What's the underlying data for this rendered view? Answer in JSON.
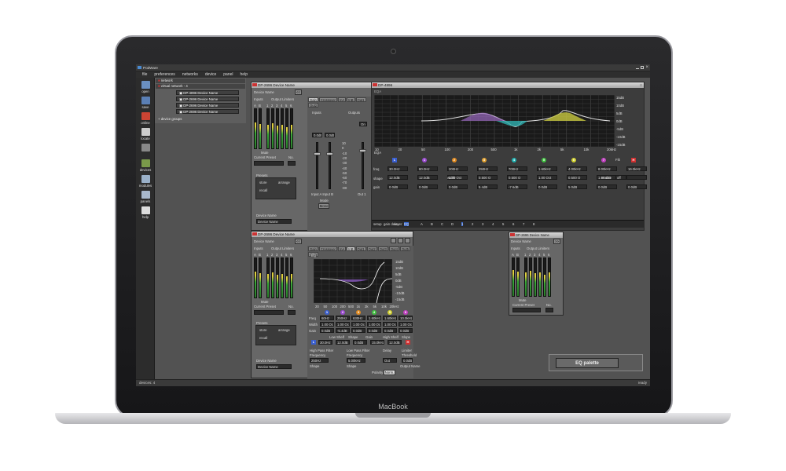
{
  "app": {
    "title": "PodWare",
    "status_devices": "devices: 4",
    "status_ready": "ready",
    "laptop_brand": "MacBook"
  },
  "menu": [
    "file",
    "preferences",
    "networks",
    "device",
    "panel",
    "help"
  ],
  "sidebar": [
    {
      "label": "open",
      "icon": "folder-icon",
      "color": "#6a8fc0"
    },
    {
      "label": "save",
      "icon": "save-icon",
      "color": "#5a7fb5"
    },
    {
      "label": "online",
      "icon": "play-icon",
      "color": "#c43"
    },
    {
      "label": "locate",
      "icon": "locate-icon",
      "color": "#ccc"
    },
    {
      "label": "",
      "icon": "gear-icon",
      "color": "#888"
    },
    {
      "label": "devices",
      "icon": "devices-icon",
      "color": "#7a9a4a"
    },
    {
      "label": "modules",
      "icon": "modules-icon",
      "color": "#9ab0c8"
    },
    {
      "label": "panels",
      "icon": "panels-icon",
      "color": "#a8b8cc"
    },
    {
      "label": "help",
      "icon": "help-icon",
      "color": "#ddd"
    }
  ],
  "tree": {
    "network": "network",
    "virtual_network": "virtual network - 4",
    "devices": [
      "DP-4896 Device Name",
      "DP-2696 Device Name",
      "DP-2696 Device Name",
      "DP-2696 Device Name"
    ],
    "groups": "device groups"
  },
  "win1": {
    "title": "DP-2696 Device Name",
    "device_name": "Device Name",
    "inputs": "Inputs",
    "output_limiters": "Output Limiters",
    "meter_labels": [
      "A",
      "B",
      "1",
      "2",
      "3",
      "4",
      "5",
      "6"
    ],
    "meter_levels": [
      0.66,
      0.62,
      0.6,
      0.64,
      0.58,
      0.6,
      0.55,
      0.6
    ],
    "mute": "Mute",
    "current_preset": "Current Preset",
    "no": "No.",
    "presets": "Presets",
    "store": "store",
    "arrange": "arrange",
    "recall": "recall",
    "device_name_label": "Device Name",
    "device_name_value": "Device Name",
    "tabs": [
      "Gain",
      "Crossover",
      "InA",
      "InB",
      "Out1",
      "Out2"
    ],
    "selected_tab": "Gain",
    "inputs_label": "Inputs",
    "outputs_label": "Outputs",
    "gain_a": "0,0dB",
    "gain_b": "0,0dB",
    "mono_toggle": "On",
    "fader_scale": [
      "10",
      "0",
      "-10",
      "-20",
      "-30",
      "-40",
      "-50",
      "-60",
      "-70",
      "-80"
    ],
    "input_ab": "Input A  Input B",
    "mode": "Mode",
    "mode_value": "Mono",
    "out": "Out 1"
  },
  "eqwin": {
    "title": "DP-4896",
    "tab_label": "EQA",
    "x_labels": [
      "10",
      "20",
      "50",
      "100",
      "200",
      "500",
      "1k",
      "2k",
      "5k",
      "10k",
      "20kHz"
    ],
    "y_labels": [
      "15dB",
      "10dB",
      "5dB",
      "0dB",
      "-5dB",
      "-10dB",
      "-15dB"
    ],
    "section": "EQA",
    "bands": [
      {
        "id": "L",
        "color": "#3a5fd0",
        "freq": "30,0Hz",
        "shape": "12,0dB",
        "gain": "0,0dB"
      },
      {
        "id": "1",
        "color": "#9a4ad0",
        "freq": "80,0Hz",
        "shape": "12,0dB",
        "gain": "0,0dB"
      },
      {
        "id": "2",
        "color": "#e08a20",
        "freq": "200Hz",
        "width": "1,00 Oct",
        "gain": "0,0dB"
      },
      {
        "id": "3",
        "color": "#e0a030",
        "freq": "250Hz",
        "width": "0,500 O",
        "gain": "5,4dB"
      },
      {
        "id": "4",
        "color": "#20b0b0",
        "freq": "700Hz",
        "width": "0,500 O",
        "gain": "-7,6dB"
      },
      {
        "id": "5",
        "color": "#40c040",
        "freq": "1,60kHz",
        "width": "1,00 Oct",
        "gain": "0,0dB"
      },
      {
        "id": "6",
        "color": "#d0d030",
        "freq": "4,00kHz",
        "width": "0,500 O",
        "gain": "5,0dB"
      },
      {
        "id": "7",
        "color": "#c040c0",
        "freq": "8,00kHz",
        "width": "1,00 Oct",
        "gain": "0,0dB"
      },
      {
        "id": "H",
        "color": "#d03030",
        "freq": "16,0kHz",
        "shape": "",
        "gain": "0,0dB"
      }
    ],
    "row_labels": [
      "freq",
      "shape",
      "gain",
      "width",
      "enable"
    ],
    "enable_value": "off",
    "filt_label": "Filt",
    "bottom_tabs": [
      "setup",
      "gain delay",
      "xover",
      "EQ",
      "A",
      "B",
      "C",
      "D",
      "1",
      "2",
      "3",
      "4",
      "5",
      "6",
      "7",
      "8"
    ]
  },
  "win2": {
    "title": "DP-2696 Device Name",
    "device_name": "Device Name",
    "inputs": "Inputs",
    "output_limiters": "Output Limiters",
    "meter_labels": [
      "A",
      "B",
      "1",
      "2",
      "3",
      "4",
      "5",
      "6"
    ],
    "meter_levels": [
      0.66,
      0.62,
      0.6,
      0.64,
      0.58,
      0.6,
      0.55,
      0.6
    ],
    "tabs": [
      "Gain",
      "Crossover",
      "InA",
      "InB",
      "Out1",
      "Out2",
      "Out3",
      "Out4",
      "Out5",
      "Out6"
    ],
    "selected_tab": "InB",
    "sub_label": "EQ",
    "y_labels": [
      "15dB",
      "10dB",
      "5dB",
      "0dB",
      "-5dB",
      "-10dB",
      "-15dB"
    ],
    "x_labels": [
      "20",
      "50",
      "100",
      "200",
      "500",
      "1k",
      "2k",
      "5k",
      "10k",
      "20kHz"
    ],
    "band_ids": [
      "1",
      "2",
      "3",
      "4",
      "5",
      "6"
    ],
    "band_colors": [
      "#3a5fd0",
      "#9a4ad0",
      "#e08a20",
      "#40c040",
      "#d0d030",
      "#c040c0"
    ],
    "freq": [
      "60Hz",
      "250Hz",
      "630Hz",
      "1,60kHz",
      "1,60kHz",
      "10,0kHz"
    ],
    "width": [
      "1,00 Oct",
      "1,00 Oct",
      "1,00 Oct",
      "1,00 Oct",
      "1,00 Oct",
      "1,00 Oct"
    ],
    "gain": [
      "0,0dB",
      "-5,4dB",
      "0,0dB",
      "0,0dB",
      "0,0dB",
      "0,0dB"
    ],
    "row_labels": [
      "Freq",
      "Width",
      "Gain"
    ],
    "low_shelf": "Low Shelf",
    "shape": "Shape",
    "gain_lbl": "Gain",
    "high_shelf": "High Shelf",
    "slope": "Slope",
    "gain_lbl2": "Gain",
    "ls_freq": "30,0Hz",
    "ls_shape": "12,0dB",
    "ls_gain": "0,0dB",
    "hs_freq": "15,0kHz",
    "hs_slope": "12,0dB",
    "hs_gain": "0,0dB",
    "hpf": "High Pass Filter",
    "lpf": "Low Pass Filter",
    "delay": "Delay",
    "limiter": "Limiter",
    "frequency": "Frequency",
    "threshold": "Threshold",
    "hpf_val": "250Hz",
    "lpf_val": "5,00kHz",
    "delay_val": "Out",
    "thr_val": "0,0dB",
    "shape2": "Shape",
    "polarity": "Polarity",
    "norm": "Norm.",
    "output_name": "Output Name",
    "mute": "Mute",
    "current_preset": "Current Preset",
    "no": "No.",
    "presets": "Presets",
    "store": "store",
    "arrange": "arrange",
    "recall": "recall",
    "device_name_label": "Device Name",
    "device_name_value": "Device Name"
  },
  "win3": {
    "title": "DP-2696 Device Name",
    "device_name": "Device Name",
    "inputs": "Inputs",
    "output_limiters": "Output Limiters",
    "meter_labels": [
      "A",
      "B",
      "1",
      "2",
      "3",
      "4",
      "5",
      "6"
    ],
    "meter_levels": [
      0.68,
      0.64,
      0.62,
      0.66,
      0.6,
      0.62,
      0.56,
      0.62
    ],
    "mute": "Mute",
    "current_preset": "Current Preset",
    "no": "No."
  },
  "palette": {
    "label": "EQ palette"
  }
}
